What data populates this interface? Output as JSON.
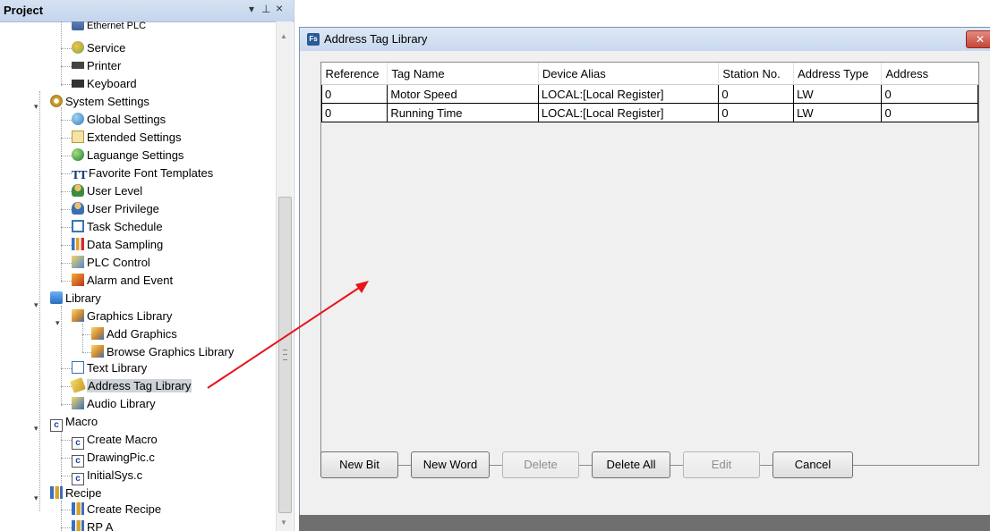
{
  "project_panel": {
    "title": "Project",
    "controls": {
      "dropdown": "▾",
      "pin": "⊥",
      "close": "×"
    },
    "tree": [
      {
        "label": "Ethernet PLC",
        "icon": "ethernet-plc-icon"
      },
      {
        "label": "Service",
        "icon": "service-icon"
      },
      {
        "label": "Printer",
        "icon": "printer-icon"
      },
      {
        "label": "Keyboard",
        "icon": "keyboard-icon"
      },
      {
        "label": "System Settings",
        "icon": "gear-icon"
      },
      {
        "label": "Global Settings",
        "icon": "global-settings-icon"
      },
      {
        "label": "Extended Settings",
        "icon": "extended-settings-icon"
      },
      {
        "label": "Laguange Settings",
        "icon": "globe-icon"
      },
      {
        "label": "Favorite Font Templates",
        "icon": "font-icon"
      },
      {
        "label": "User Level",
        "icon": "user-level-icon"
      },
      {
        "label": "User Privilege",
        "icon": "user-privilege-icon"
      },
      {
        "label": "Task Schedule",
        "icon": "calendar-icon"
      },
      {
        "label": "Data Sampling",
        "icon": "bar-chart-icon"
      },
      {
        "label": "PLC Control",
        "icon": "plc-control-icon"
      },
      {
        "label": "Alarm and Event",
        "icon": "alarm-icon"
      },
      {
        "label": "Library",
        "icon": "library-icon"
      },
      {
        "label": "Graphics Library",
        "icon": "graphics-library-icon"
      },
      {
        "label": "Add Graphics",
        "icon": "add-graphics-icon"
      },
      {
        "label": "Browse Graphics Library",
        "icon": "browse-graphics-icon"
      },
      {
        "label": "Text Library",
        "icon": "text-library-icon"
      },
      {
        "label": "Address Tag Library",
        "icon": "tag-icon",
        "selected": true
      },
      {
        "label": "Audio Library",
        "icon": "audio-library-icon"
      },
      {
        "label": "Macro",
        "icon": "macro-icon"
      },
      {
        "label": "Create Macro",
        "icon": "create-macro-icon"
      },
      {
        "label": "DrawingPic.c",
        "icon": "c-file-icon"
      },
      {
        "label": "InitialSys.c",
        "icon": "c-file-icon"
      },
      {
        "label": "Recipe",
        "icon": "recipe-icon"
      },
      {
        "label": "Create Recipe",
        "icon": "create-recipe-icon"
      },
      {
        "label": "RP A",
        "icon": "recipe-item-icon"
      }
    ],
    "expander_glyph": "▾",
    "scrollbar": {
      "up": "▲",
      "down": "▼",
      "grip": "≡"
    }
  },
  "dialog": {
    "app_icon": "Fs",
    "title": "Address Tag Library",
    "close_glyph": "✕",
    "table": {
      "columns": [
        "Reference",
        "Tag Name",
        "Device Alias",
        "Station No.",
        "Address Type",
        "Address"
      ],
      "rows": [
        [
          "0",
          "Motor Speed",
          "LOCAL:[Local Register]",
          "0",
          "LW",
          "0"
        ],
        [
          "0",
          "Running Time",
          "LOCAL:[Local Register]",
          "0",
          "LW",
          "0"
        ]
      ]
    },
    "buttons": {
      "new_bit": "New Bit",
      "new_word": "New Word",
      "delete": "Delete",
      "delete_all": "Delete All",
      "edit": "Edit",
      "cancel": "Cancel"
    }
  },
  "colors": {
    "annotation_arrow": "#e8141a",
    "header_gradient_top": "#d5e2f2",
    "selected_row": "#cfd3d8"
  }
}
